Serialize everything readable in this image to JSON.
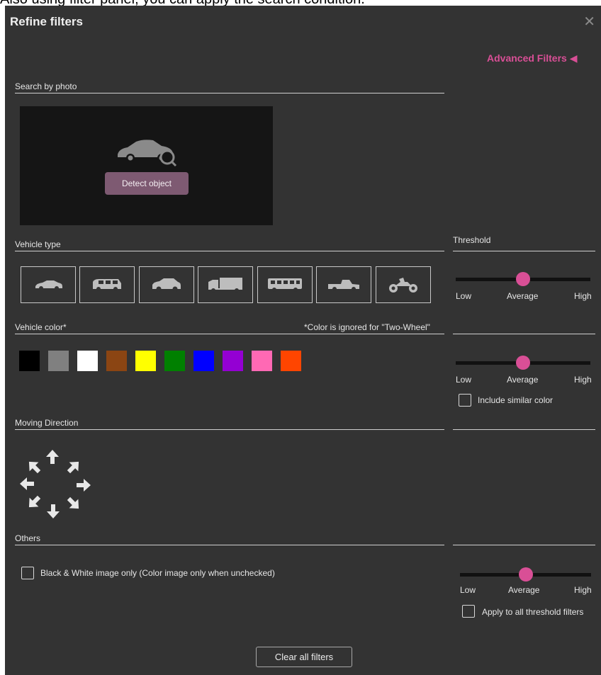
{
  "caption": "Also using filter panel, you can apply the search condition.",
  "header": {
    "title": "Refine filters",
    "close_glyph": "✕"
  },
  "advanced_filters": {
    "label": "Advanced Filters",
    "glyph": "◀"
  },
  "search_by_photo": {
    "label": "Search by photo",
    "detect_button": "Detect object",
    "icon": "car-search-icon"
  },
  "vehicle_type": {
    "label": "Vehicle type",
    "items": [
      {
        "name": "sedan",
        "icon": "sedan-icon"
      },
      {
        "name": "van",
        "icon": "van-icon"
      },
      {
        "name": "suv",
        "icon": "suv-icon"
      },
      {
        "name": "truck",
        "icon": "truck-icon"
      },
      {
        "name": "bus",
        "icon": "bus-icon"
      },
      {
        "name": "pickup",
        "icon": "pickup-icon"
      },
      {
        "name": "two-wheel",
        "icon": "motorcycle-icon"
      }
    ]
  },
  "threshold": {
    "label": "Threshold",
    "low": "Low",
    "average": "Average",
    "high": "High",
    "type_level": 0.5,
    "color_level": 0.5,
    "others_level": 0.5
  },
  "vehicle_color": {
    "label": "Vehicle color*",
    "note": "*Color is ignored for \"Two-Wheel\"",
    "swatches": [
      "#000000",
      "#808080",
      "#ffffff",
      "#8b4513",
      "#ffff00",
      "#008000",
      "#0000ff",
      "#9400d3",
      "#ff69b4",
      "#ff4500"
    ],
    "include_similar": "Include similar color"
  },
  "moving_direction": {
    "label": "Moving Direction"
  },
  "others": {
    "label": "Others",
    "bw_only": "Black & White image only (Color image only when unchecked)",
    "apply_all": "Apply to all threshold filters"
  },
  "footer": {
    "clear_button": "Clear all filters"
  }
}
